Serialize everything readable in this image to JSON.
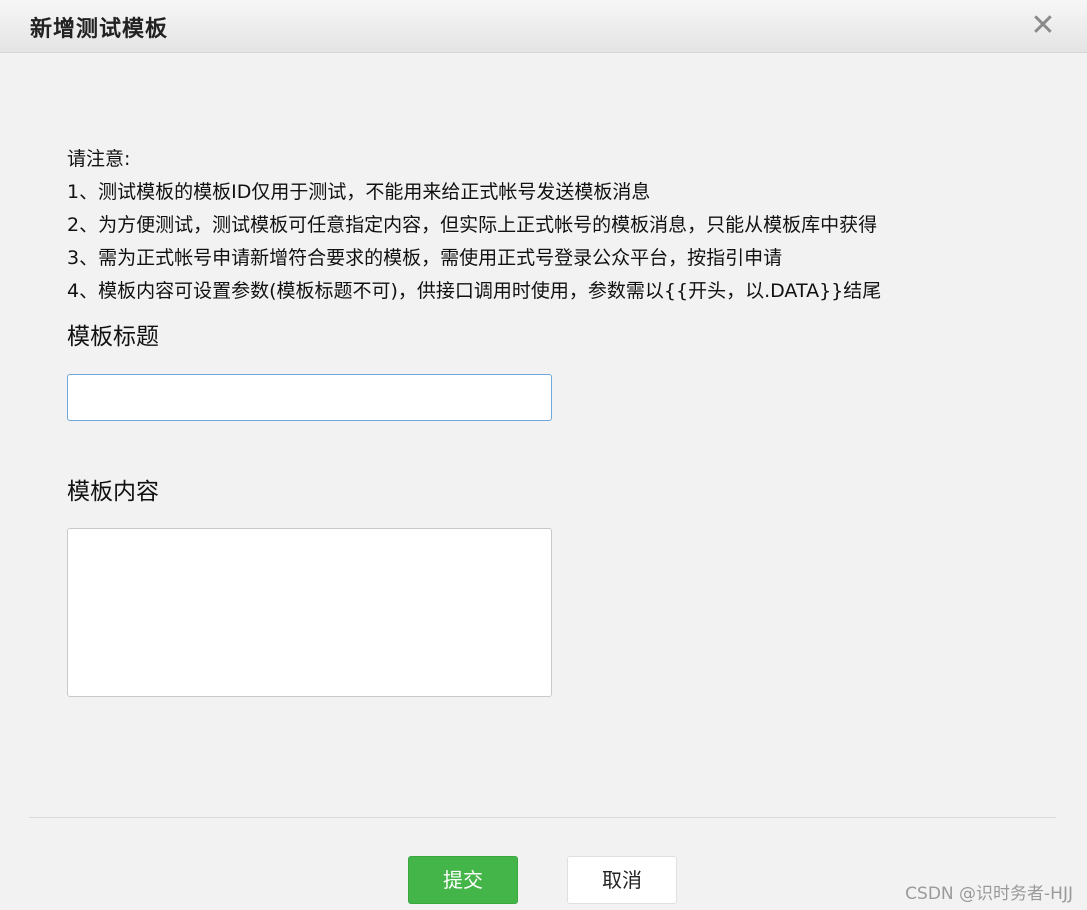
{
  "dialog": {
    "title": "新增测试模板",
    "close_icon": "close-icon",
    "close_symbol": "✕"
  },
  "notice": {
    "heading": "请注意:",
    "items": [
      "1、测试模板的模板ID仅用于测试，不能用来给正式帐号发送模板消息",
      "2、为方便测试，测试模板可任意指定内容，但实际上正式帐号的模板消息，只能从模板库中获得",
      "3、需为正式帐号申请新增符合要求的模板，需使用正式号登录公众平台，按指引申请",
      "4、模板内容可设置参数(模板标题不可)，供接口调用时使用，参数需以{{开头，以.DATA}}结尾"
    ]
  },
  "form": {
    "title_label": "模板标题",
    "title_value": "",
    "content_label": "模板内容",
    "content_value": ""
  },
  "actions": {
    "submit_label": "提交",
    "cancel_label": "取消"
  },
  "watermark": "CSDN @识时务者-HJJ",
  "colors": {
    "submit_bg": "#44b549",
    "input_focus_border": "#6fa8dc",
    "background": "#f2f2f2"
  }
}
